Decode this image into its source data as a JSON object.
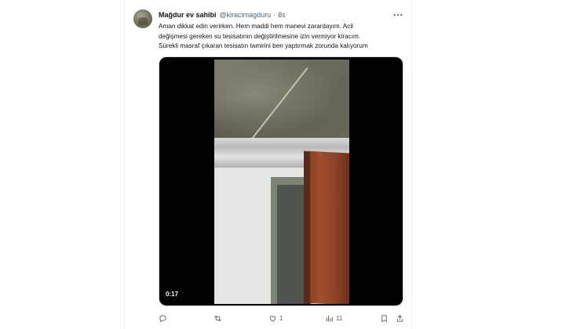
{
  "tweet": {
    "display_name": "Mağdur ev sahibi",
    "handle": "@kiracimagduru",
    "separator": "·",
    "time": "8s",
    "text_lines": [
      "Aman dikkat edin verirken. Hem maddi hem manevi zarardayım. Acil",
      "değişmesi gereken su tesisatının değiştirilmesine izin vermiyor kiracım.",
      "Sürekli masraf çıkaran tesisatın tamirini ben yaptırmak zorunda kalıyorum"
    ],
    "video_time": "0:17"
  },
  "actions": {
    "reply_icon": "reply-icon",
    "retweet_icon": "retweet-icon",
    "like_icon": "like-icon",
    "like_count": "1",
    "views_icon": "views-icon",
    "views_count": "11",
    "bookmark_icon": "bookmark-icon",
    "share_icon": "share-icon"
  },
  "colors": {
    "text_primary": "#0f1419",
    "text_secondary": "#536471",
    "media_background": "#000000"
  }
}
